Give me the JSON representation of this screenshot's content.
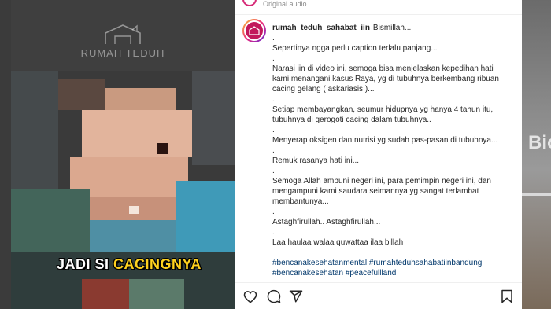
{
  "video": {
    "watermark_text": "RUMAH TEDUH",
    "caption_prefix": "JADI SI ",
    "caption_highlight": "CACINGNYA"
  },
  "post": {
    "topbar_text": "Original audio",
    "username": "rumah_teduh_sahabat_iin",
    "first_line": "Bismillah...",
    "lines": [
      ".",
      "Sepertinya ngga perlu caption terlalu panjang...",
      ".",
      "Narasi iin di video ini, semoga bisa menjelaskan kepedihan hati kami menangani kasus Raya, yg di tubuhnya berkembang ribuan cacing gelang ( askariasis )...",
      ".",
      "Setiap membayangkan, seumur hidupnya yg hanya 4 tahun itu, tubuhnya di gerogoti cacing dalam tubuhnya..",
      ".",
      "Menyerap oksigen dan nutrisi yg sudah pas-pasan di tubuhnya...",
      ".",
      "Remuk rasanya hati ini...",
      ".",
      "Semoga Allah ampuni negeri ini, para pemimpin negeri ini, dan mengampuni kami saudara seimannya yg sangat terlambat membantunya...",
      ".",
      "Astaghfirullah.. Astaghfirullah...",
      ".",
      "Laa haulaa walaa quwattaa ilaa billah"
    ],
    "hashtags_line1": "#bencanakesehatanmental #rumahteduhsahabatiinbandung",
    "hashtags_line2": "#bencanakesehatan #peacefullland"
  },
  "background": {
    "right_text": "Bio"
  },
  "colors": {
    "hashtag": "#00376b",
    "caption_highlight": "#ffd21e",
    "avatar_ring": "#ee2a7b"
  },
  "icons": [
    "heart-icon",
    "comment-icon",
    "share-icon",
    "bookmark-icon"
  ]
}
